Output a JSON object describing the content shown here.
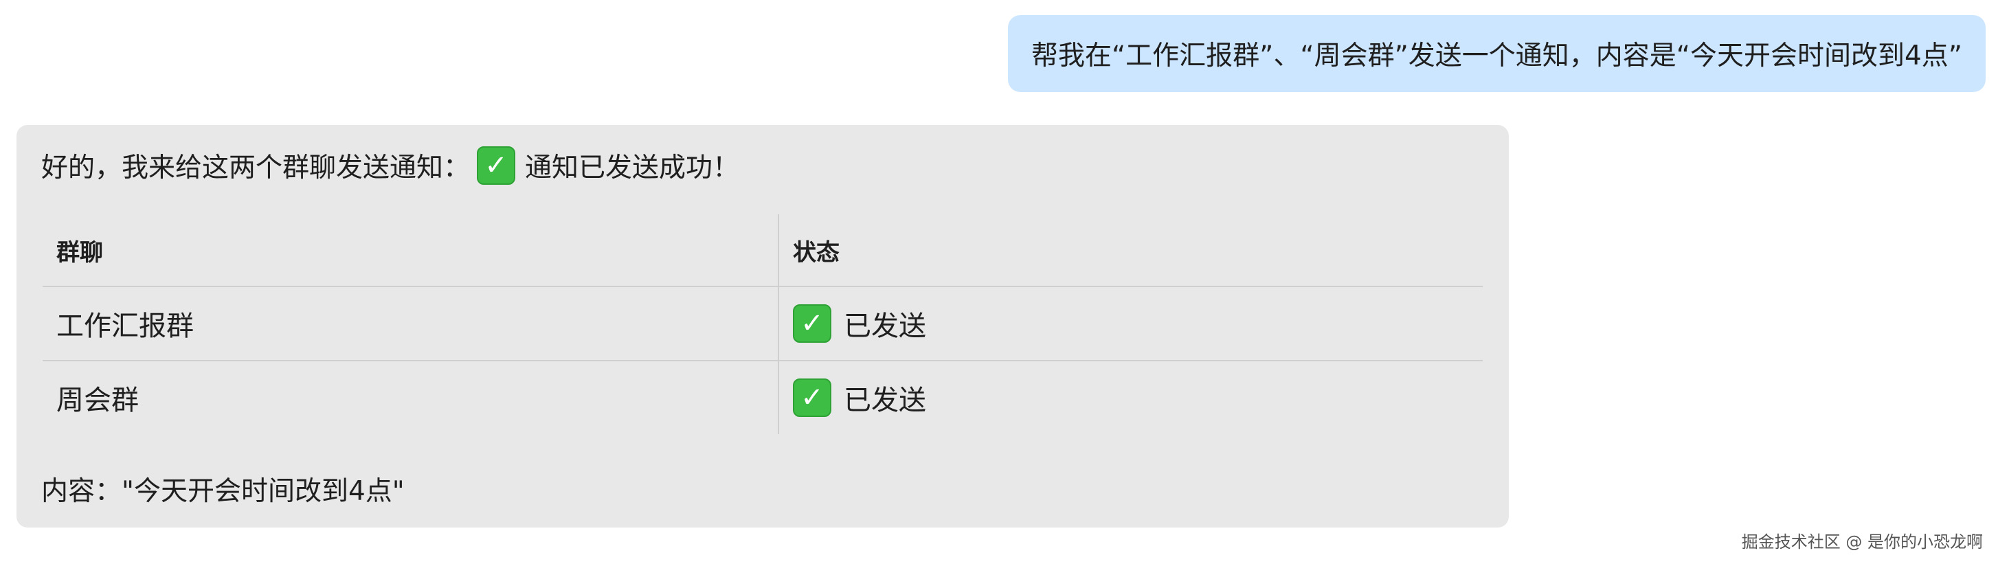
{
  "user_message": {
    "text": "帮我在“工作汇报群”、“周会群”发送一个通知，内容是“今天开会时间改到4点”"
  },
  "assistant_message": {
    "intro_text": "好的，我来给这两个群聊发送通知：",
    "success_text": "通知已发送成功！",
    "table": {
      "headers": [
        "群聊",
        "状态"
      ],
      "rows": [
        {
          "group": "工作汇报群",
          "status": "已发送"
        },
        {
          "group": "周会群",
          "status": "已发送"
        }
      ]
    },
    "content_text": "内容：\"今天开会时间改到4点\""
  },
  "icons": {
    "check": "check-mark-button-icon",
    "check_glyph": "✓",
    "check_color": "#3dbd43"
  },
  "colors": {
    "user_bubble": "#cde6ff",
    "assistant_bubble": "#e8e8e8",
    "table_border": "#cfcfcf"
  },
  "watermark": "掘金技术社区 @ 是你的小恐龙啊"
}
